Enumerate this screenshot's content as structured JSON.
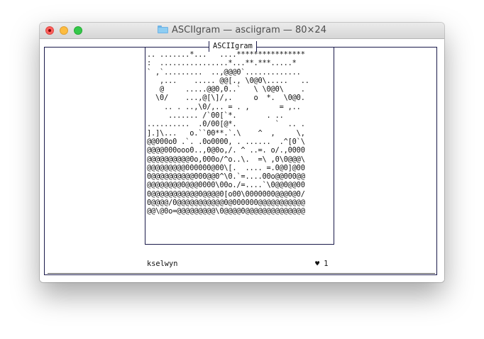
{
  "window": {
    "title": "ASCIIgram — asciigram — 80×24",
    "traffic_lights": [
      "close",
      "minimize",
      "zoom"
    ],
    "folder_icon": "folder-icon"
  },
  "panel": {
    "title": "ASCIIgram"
  },
  "post": {
    "art": ".. .......*...   ....****************\n:  ................*...**.***.....*\n` ,`.........  ..,@@@0`.............\n   ,...    ..... @@[., \\0@0\\.....   ..\n   @     .....@@0,0..`   \\ \\0@0\\    .\n  \\0/    ...,@[\\]/,.     o  *.  \\0@0.\n    .. . ..,\\0/,.. = . ,       = ,..\n     ....... /`00[`*.       . ..\n..........  .0/00[@*.         `  .. .\n].]\\...   o.``00**.`.\\    ^  ,     \\,\n@@000o0 .`. .0o0000, . ......  .^[0`\\\n@@@@000ooo0..,0@0o,/. ^ ..=. o/.,0000\n@@@@@@@@@@0o,000o/^o..\\.  =\\ ,0\\0@@@\\\n@@@@@@@@@000000@00\\[.  .... =.0@0]@00\n0@@@@@@@@@@000@@0^\\0.`=....00o@@000@@\n@@@@@@@@0@@@0000\\00o./=....`\\0@@0@@00\n0@@@@@@@@@@@0@@@@0[o00\\0000000@@@0@0/\n0@@@@/0@@@@@@@@@@@0@000000@@@@@@@@@@@\n@@\\@0o=@@@@@@@@@\\0@@@@0@@@@@@@@@@@@@@",
    "username": "kselwyn",
    "heart_icon": "heart-icon",
    "heart_glyph": "♥",
    "likes": "1"
  }
}
